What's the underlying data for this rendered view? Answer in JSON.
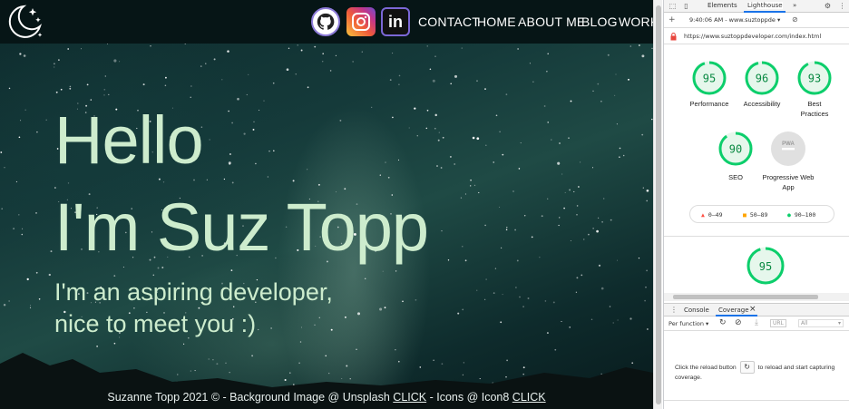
{
  "site": {
    "nav": {
      "contact": "CONTACT",
      "home": "HOME",
      "about": "ABOUT ME",
      "blog": "BLOG",
      "work": "WORK"
    },
    "social_icons": [
      "github-icon",
      "instagram-icon",
      "linkedin-icon"
    ],
    "linkedin_text": "in",
    "hero": {
      "line1": "Hello",
      "line2": "I'm Suz Topp",
      "sub1": "I'm an aspiring developer,",
      "sub2": "nice to meet you :)"
    },
    "footer": {
      "prefix": "Suzanne Topp 2021 © - Background Image @ Unsplash ",
      "link1": "CLICK",
      "middle": " - Icons @ Icon8 ",
      "link2": "CLICK"
    },
    "colors": {
      "hero_text": "#cdeccd",
      "topbar": "#061516"
    }
  },
  "devtools": {
    "tabs": {
      "elements": "Elements",
      "lighthouse": "Lighthouse",
      "more": "»"
    },
    "toolbar": {
      "report": "9:40:06 AM - www.suztoppde",
      "dropdown": "▾"
    },
    "url": "https://www.suztoppdeveloper.com/index.html",
    "scores": [
      {
        "label": "Performance",
        "value": "95"
      },
      {
        "label": "Accessibility",
        "value": "96"
      },
      {
        "label": "Best Practices",
        "value": "93"
      },
      {
        "label": "SEO",
        "value": "90"
      },
      {
        "label": "Progressive Web App",
        "value": "PWA"
      }
    ],
    "legend": {
      "low": "0–49",
      "mid": "50–89",
      "high": "90–100"
    },
    "performance_gauge": "95",
    "drawer": {
      "console": "Console",
      "coverage": "Coverage",
      "close": "×"
    },
    "coverage": {
      "per_function": "Per function",
      "url_placeholder": "URL",
      "all_option": "All",
      "msg_before": "Click the reload button",
      "msg_after": "to reload and start capturing coverage."
    },
    "colors": {
      "pass": "#0cce6b",
      "pass_text": "#0a8a43",
      "average": "#ffa400",
      "fail": "#ff4e42",
      "tab_accent": "#1a73e8"
    }
  }
}
